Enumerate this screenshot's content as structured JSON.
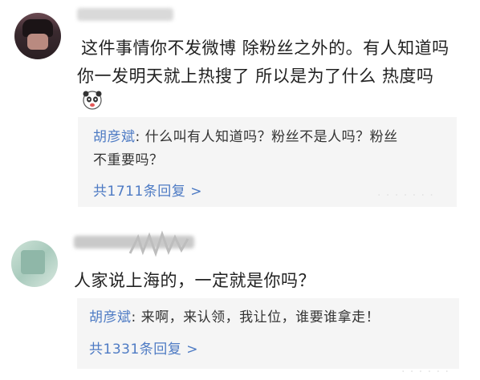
{
  "comments": [
    {
      "text_line1": "这件事情你不发微博 除粉丝之外的。有人知道吗",
      "text_line2": "你一发明天就上热搜了 所以是为了什么 热度吗",
      "emoji": "panda-face-emoji",
      "reply": {
        "author": "胡彦斌",
        "separator": ": ",
        "body_line1": "什么叫有人知道吗？粉丝不是人吗？粉丝",
        "body_line2": "不重要吗？",
        "more": "共1711条回复",
        "more_chevron": ">"
      }
    },
    {
      "text": "人家说上海的，一定就是你吗？",
      "reply": {
        "author": "胡彦斌",
        "separator": ": ",
        "body_line1": "来啊，来认领，我让位，谁要谁拿走！",
        "more": "共1331条回复",
        "more_chevron": ">"
      }
    }
  ],
  "colors": {
    "link": "#4e7bc4",
    "reply_bg": "#f5f5f5",
    "text": "#222222"
  }
}
